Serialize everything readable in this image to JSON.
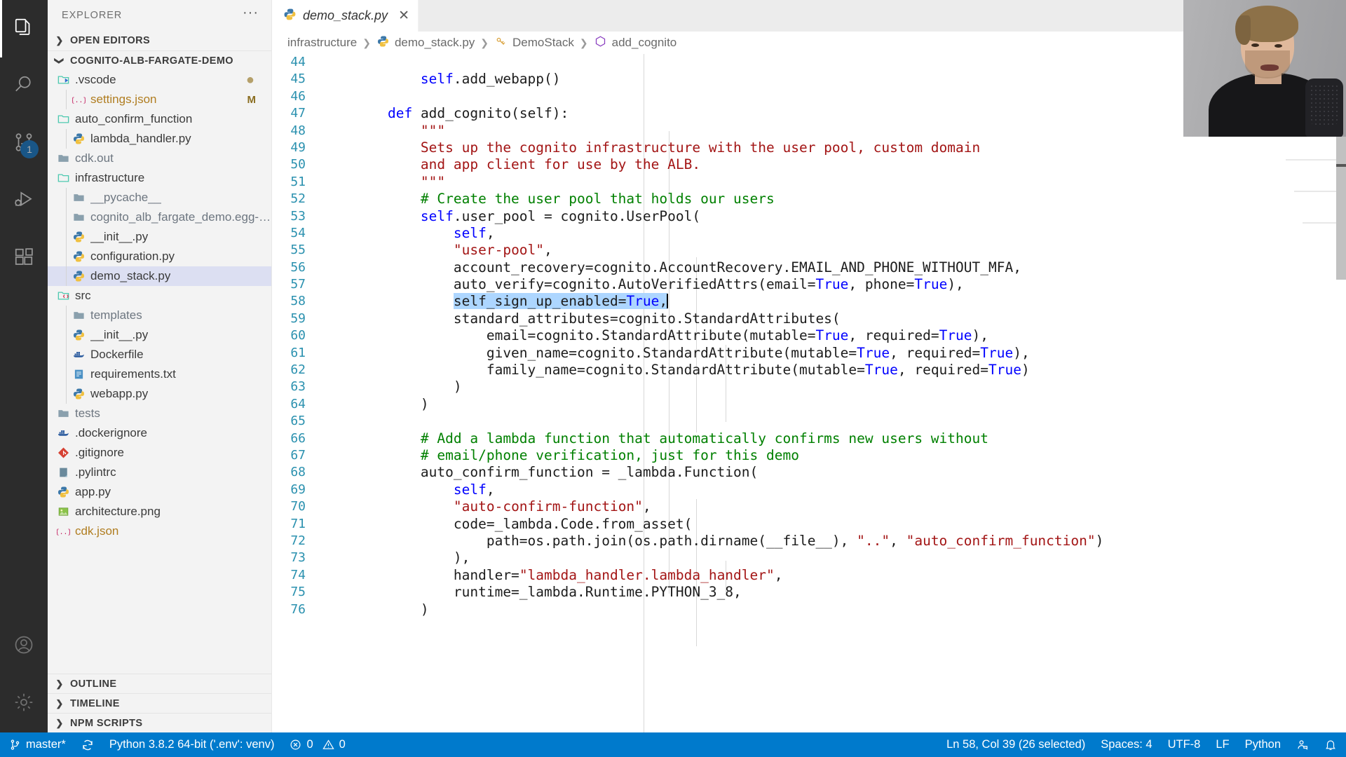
{
  "activitybar": {
    "items": [
      {
        "name": "explorer",
        "icon": "files-icon",
        "active": true
      },
      {
        "name": "search",
        "icon": "search-icon",
        "active": false
      },
      {
        "name": "source-control",
        "icon": "source-control-icon",
        "active": false,
        "badge": "1"
      },
      {
        "name": "run-and-debug",
        "icon": "run-debug-icon",
        "active": false
      },
      {
        "name": "extensions",
        "icon": "extensions-icon",
        "active": false
      }
    ],
    "bottom": [
      {
        "name": "accounts",
        "icon": "account-icon"
      },
      {
        "name": "manage",
        "icon": "gear-icon"
      }
    ]
  },
  "sidebar": {
    "title": "EXPLORER",
    "more_actions": "···",
    "sections": {
      "open_editors": "OPEN EDITORS",
      "project": "COGNITO-ALB-FARGATE-DEMO",
      "outline": "OUTLINE",
      "timeline": "TIMELINE",
      "npm_scripts": "NPM SCRIPTS"
    },
    "files": [
      {
        "label": ".vscode",
        "icon": "folder-vscode-icon",
        "indent": 0,
        "kind": "folder-open",
        "status_dot": "●"
      },
      {
        "label": "settings.json",
        "icon": "json-icon",
        "indent": 1,
        "kind": "file",
        "badge": "M"
      },
      {
        "label": "auto_confirm_function",
        "icon": "folder-icon",
        "indent": 0,
        "kind": "folder-open"
      },
      {
        "label": "lambda_handler.py",
        "icon": "python-icon",
        "indent": 1,
        "kind": "file"
      },
      {
        "label": "cdk.out",
        "icon": "folder-closed-icon",
        "indent": 0,
        "kind": "folder"
      },
      {
        "label": "infrastructure",
        "icon": "folder-icon",
        "indent": 0,
        "kind": "folder-open"
      },
      {
        "label": "__pycache__",
        "icon": "folder-closed-icon",
        "indent": 1,
        "kind": "folder"
      },
      {
        "label": "cognito_alb_fargate_demo.egg-info",
        "icon": "folder-closed-icon",
        "indent": 1,
        "kind": "folder"
      },
      {
        "label": "__init__.py",
        "icon": "python-icon",
        "indent": 1,
        "kind": "file"
      },
      {
        "label": "configuration.py",
        "icon": "python-icon",
        "indent": 1,
        "kind": "file"
      },
      {
        "label": "demo_stack.py",
        "icon": "python-icon",
        "indent": 1,
        "kind": "file",
        "selected": true
      },
      {
        "label": "src",
        "icon": "folder-src-icon",
        "indent": 0,
        "kind": "folder-open"
      },
      {
        "label": "templates",
        "icon": "folder-closed-icon",
        "indent": 1,
        "kind": "folder"
      },
      {
        "label": "__init__.py",
        "icon": "python-icon",
        "indent": 1,
        "kind": "file"
      },
      {
        "label": "Dockerfile",
        "icon": "docker-icon",
        "indent": 1,
        "kind": "file"
      },
      {
        "label": "requirements.txt",
        "icon": "text-icon",
        "indent": 1,
        "kind": "file"
      },
      {
        "label": "webapp.py",
        "icon": "python-icon",
        "indent": 1,
        "kind": "file"
      },
      {
        "label": "tests",
        "icon": "folder-closed-icon",
        "indent": 0,
        "kind": "folder"
      },
      {
        "label": ".dockerignore",
        "icon": "docker-icon",
        "indent": 0,
        "kind": "file"
      },
      {
        "label": ".gitignore",
        "icon": "git-icon",
        "indent": 0,
        "kind": "file"
      },
      {
        "label": ".pylintrc",
        "icon": "config-icon",
        "indent": 0,
        "kind": "file"
      },
      {
        "label": "app.py",
        "icon": "python-icon",
        "indent": 0,
        "kind": "file"
      },
      {
        "label": "architecture.png",
        "icon": "image-icon",
        "indent": 0,
        "kind": "file"
      },
      {
        "label": "cdk.json",
        "icon": "json-icon",
        "indent": 0,
        "kind": "file"
      }
    ]
  },
  "editor": {
    "tab": {
      "label": "demo_stack.py",
      "icon": "python-icon",
      "close": "✕",
      "preview": true
    },
    "breadcrumb": [
      {
        "label": "infrastructure",
        "icon": null
      },
      {
        "label": "demo_stack.py",
        "icon": "python-icon"
      },
      {
        "label": "DemoStack",
        "icon": "class-icon"
      },
      {
        "label": "add_cognito",
        "icon": "method-icon"
      }
    ],
    "breadcrumb_separator": "❯",
    "first_line_number": 44,
    "lines": [
      {
        "n": 44,
        "tokens": [
          {
            "t": "",
            "c": "plain"
          }
        ]
      },
      {
        "n": 45,
        "tokens": [
          {
            "t": "        ",
            "c": "plain"
          },
          {
            "t": "self",
            "c": "kw"
          },
          {
            "t": ".add_webapp()",
            "c": "plain"
          }
        ]
      },
      {
        "n": 46,
        "tokens": [
          {
            "t": "",
            "c": "plain"
          }
        ]
      },
      {
        "n": 47,
        "tokens": [
          {
            "t": "    ",
            "c": "plain"
          },
          {
            "t": "def",
            "c": "kw"
          },
          {
            "t": " add_cognito(self):",
            "c": "plain"
          }
        ]
      },
      {
        "n": 48,
        "tokens": [
          {
            "t": "        ",
            "c": "plain"
          },
          {
            "t": "\"\"\"",
            "c": "str"
          }
        ]
      },
      {
        "n": 49,
        "tokens": [
          {
            "t": "        ",
            "c": "plain"
          },
          {
            "t": "Sets up the cognito infrastructure with the user pool, custom domain",
            "c": "str"
          }
        ]
      },
      {
        "n": 50,
        "tokens": [
          {
            "t": "        ",
            "c": "plain"
          },
          {
            "t": "and app client for use by the ALB.",
            "c": "str"
          }
        ]
      },
      {
        "n": 51,
        "tokens": [
          {
            "t": "        ",
            "c": "plain"
          },
          {
            "t": "\"\"\"",
            "c": "str"
          }
        ]
      },
      {
        "n": 52,
        "tokens": [
          {
            "t": "        ",
            "c": "plain"
          },
          {
            "t": "# Create the user pool that holds our users",
            "c": "cmt"
          }
        ]
      },
      {
        "n": 53,
        "tokens": [
          {
            "t": "        ",
            "c": "plain"
          },
          {
            "t": "self",
            "c": "kw"
          },
          {
            "t": ".user_pool = cognito.UserPool(",
            "c": "plain"
          }
        ]
      },
      {
        "n": 54,
        "tokens": [
          {
            "t": "            ",
            "c": "plain"
          },
          {
            "t": "self",
            "c": "kw"
          },
          {
            "t": ",",
            "c": "plain"
          }
        ]
      },
      {
        "n": 55,
        "tokens": [
          {
            "t": "            ",
            "c": "plain"
          },
          {
            "t": "\"user-pool\"",
            "c": "str"
          },
          {
            "t": ",",
            "c": "plain"
          }
        ]
      },
      {
        "n": 56,
        "tokens": [
          {
            "t": "            account_recovery=cognito.AccountRecovery.EMAIL_AND_PHONE_WITHOUT_MFA,",
            "c": "plain"
          }
        ]
      },
      {
        "n": 57,
        "tokens": [
          {
            "t": "            auto_verify=cognito.AutoVerifiedAttrs(email=",
            "c": "plain"
          },
          {
            "t": "True",
            "c": "kw"
          },
          {
            "t": ", phone=",
            "c": "plain"
          },
          {
            "t": "True",
            "c": "kw"
          },
          {
            "t": "),",
            "c": "plain"
          }
        ]
      },
      {
        "n": 58,
        "selected_line": true,
        "tokens": [
          {
            "t": "            ",
            "c": "plain"
          },
          {
            "t": "self_sign_up_enabled=",
            "c": "plain sel"
          },
          {
            "t": "True",
            "c": "kw sel"
          },
          {
            "t": ",",
            "c": "plain sel"
          },
          {
            "t": "|",
            "c": "caret"
          }
        ]
      },
      {
        "n": 59,
        "tokens": [
          {
            "t": "            standard_attributes=cognito.StandardAttributes(",
            "c": "plain"
          }
        ]
      },
      {
        "n": 60,
        "tokens": [
          {
            "t": "                email=cognito.StandardAttribute(mutable=",
            "c": "plain"
          },
          {
            "t": "True",
            "c": "kw"
          },
          {
            "t": ", required=",
            "c": "plain"
          },
          {
            "t": "True",
            "c": "kw"
          },
          {
            "t": "),",
            "c": "plain"
          }
        ]
      },
      {
        "n": 61,
        "tokens": [
          {
            "t": "                given_name=cognito.StandardAttribute(mutable=",
            "c": "plain"
          },
          {
            "t": "True",
            "c": "kw"
          },
          {
            "t": ", required=",
            "c": "plain"
          },
          {
            "t": "True",
            "c": "kw"
          },
          {
            "t": "),",
            "c": "plain"
          }
        ]
      },
      {
        "n": 62,
        "tokens": [
          {
            "t": "                family_name=cognito.StandardAttribute(mutable=",
            "c": "plain"
          },
          {
            "t": "True",
            "c": "kw"
          },
          {
            "t": ", required=",
            "c": "plain"
          },
          {
            "t": "True",
            "c": "kw"
          },
          {
            "t": ")",
            "c": "plain"
          }
        ]
      },
      {
        "n": 63,
        "tokens": [
          {
            "t": "            )",
            "c": "plain"
          }
        ]
      },
      {
        "n": 64,
        "tokens": [
          {
            "t": "        )",
            "c": "plain"
          }
        ]
      },
      {
        "n": 65,
        "tokens": [
          {
            "t": "",
            "c": "plain"
          }
        ]
      },
      {
        "n": 66,
        "tokens": [
          {
            "t": "        ",
            "c": "plain"
          },
          {
            "t": "# Add a lambda function that automatically confirms new users without",
            "c": "cmt"
          }
        ]
      },
      {
        "n": 67,
        "tokens": [
          {
            "t": "        ",
            "c": "plain"
          },
          {
            "t": "# email/phone verification, just for this demo",
            "c": "cmt"
          }
        ]
      },
      {
        "n": 68,
        "tokens": [
          {
            "t": "        auto_confirm_function = _lambda.Function(",
            "c": "plain"
          }
        ]
      },
      {
        "n": 69,
        "tokens": [
          {
            "t": "            ",
            "c": "plain"
          },
          {
            "t": "self",
            "c": "kw"
          },
          {
            "t": ",",
            "c": "plain"
          }
        ]
      },
      {
        "n": 70,
        "tokens": [
          {
            "t": "            ",
            "c": "plain"
          },
          {
            "t": "\"auto-confirm-function\"",
            "c": "str"
          },
          {
            "t": ",",
            "c": "plain"
          }
        ]
      },
      {
        "n": 71,
        "tokens": [
          {
            "t": "            code=_lambda.Code.from_asset(",
            "c": "plain"
          }
        ]
      },
      {
        "n": 72,
        "tokens": [
          {
            "t": "                path=os.path.join(os.path.dirname(__file__), ",
            "c": "plain"
          },
          {
            "t": "\"..\"",
            "c": "str"
          },
          {
            "t": ", ",
            "c": "plain"
          },
          {
            "t": "\"auto_confirm_function\"",
            "c": "str"
          },
          {
            "t": ")",
            "c": "plain"
          }
        ]
      },
      {
        "n": 73,
        "tokens": [
          {
            "t": "            ),",
            "c": "plain"
          }
        ]
      },
      {
        "n": 74,
        "tokens": [
          {
            "t": "            handler=",
            "c": "plain"
          },
          {
            "t": "\"lambda_handler.lambda_handler\"",
            "c": "str"
          },
          {
            "t": ",",
            "c": "plain"
          }
        ]
      },
      {
        "n": 75,
        "tokens": [
          {
            "t": "            runtime=_lambda.Runtime.PYTHON_3_8,",
            "c": "plain"
          }
        ]
      },
      {
        "n": 76,
        "tokens": [
          {
            "t": "        )",
            "c": "plain"
          }
        ]
      }
    ]
  },
  "statusbar": {
    "branch": "master*",
    "branch_icon": "source-control-icon",
    "sync_icon": "sync-icon",
    "interpreter": "Python 3.8.2 64-bit ('.env': venv)",
    "errors_icon": "error-icon",
    "errors": "0",
    "warnings_icon": "warning-icon",
    "warnings": "0",
    "cursor_position": "Ln 58, Col 39 (26 selected)",
    "indentation": "Spaces: 4",
    "encoding": "UTF-8",
    "eol": "LF",
    "language": "Python",
    "feedback_icon": "feedback-icon",
    "bell_icon": "bell-icon"
  },
  "colors": {
    "accent": "#007acc",
    "selection": "#add6ff",
    "keyword": "#0000ff",
    "string": "#a31515",
    "comment": "#008000",
    "line_number": "#2b91af",
    "sidebar_bg": "#f3f3f3",
    "activitybar_bg": "#2c2c2c",
    "tree_selected": "#dcdff2"
  }
}
